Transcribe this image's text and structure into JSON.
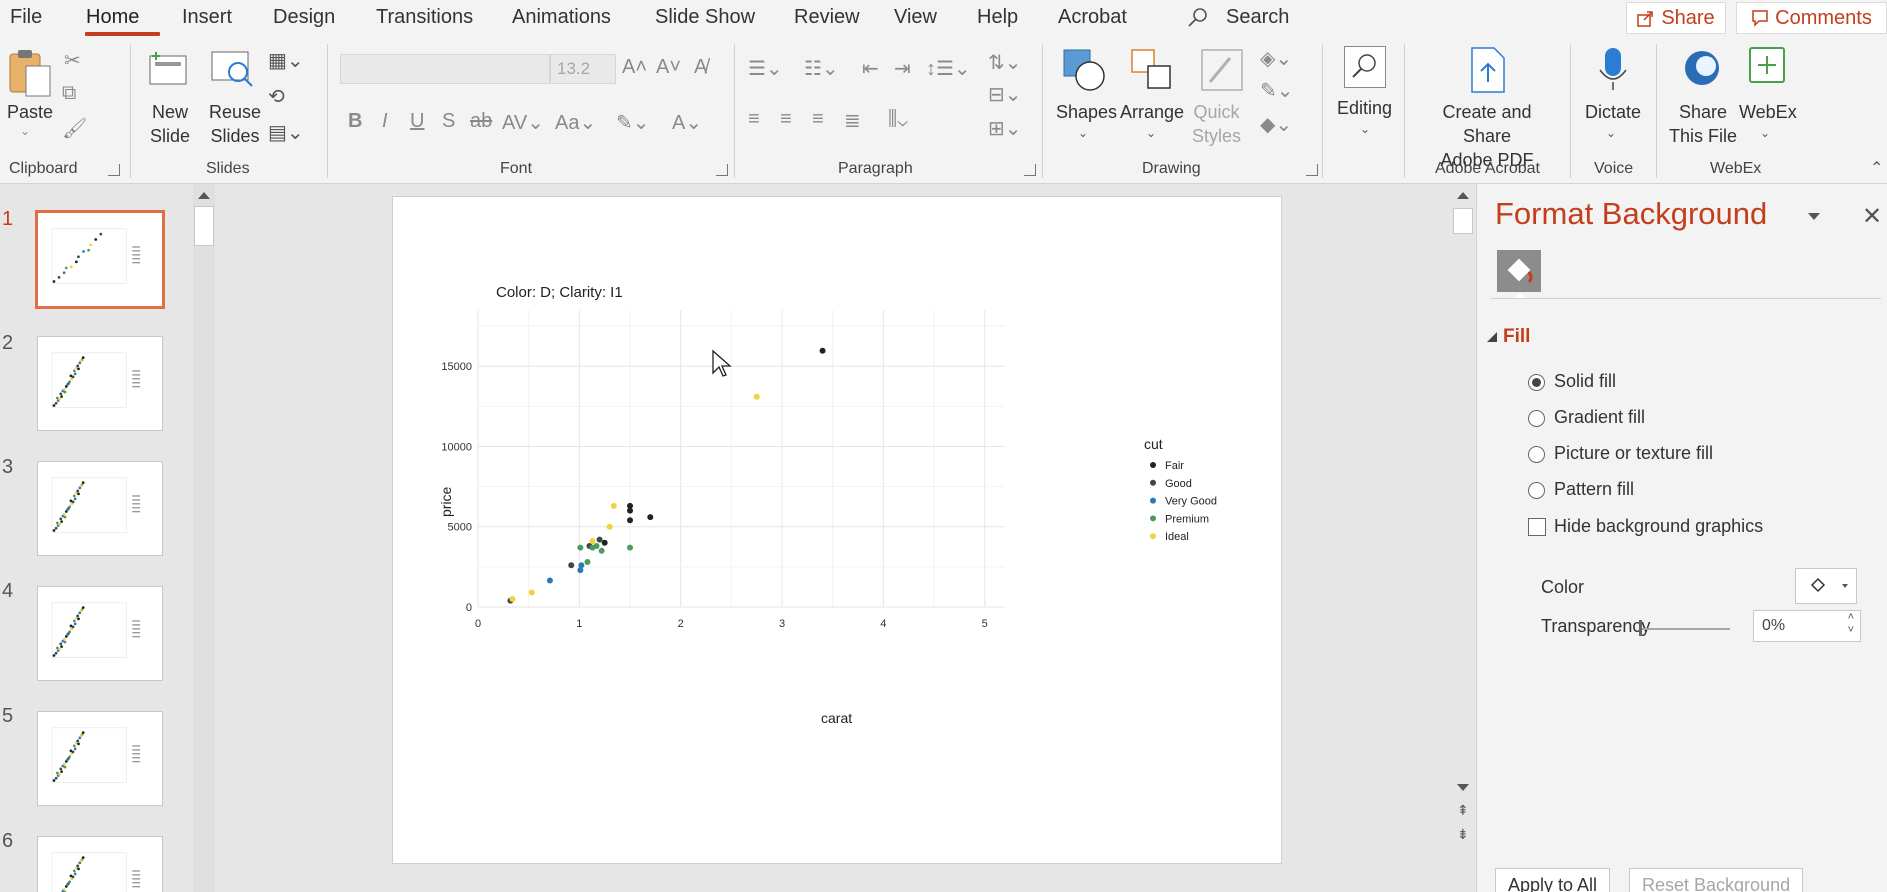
{
  "menu": {
    "items": [
      "File",
      "Home",
      "Insert",
      "Design",
      "Transitions",
      "Animations",
      "Slide Show",
      "Review",
      "View",
      "Help",
      "Acrobat"
    ],
    "active": "Home",
    "search_label": "Search",
    "share_label": "Share",
    "comments_label": "Comments"
  },
  "ribbon": {
    "clipboard": {
      "paste_label": "Paste",
      "group_label": "Clipboard"
    },
    "slides": {
      "new_slide_label": "New\nSlide",
      "reuse_slides_label": "Reuse\nSlides",
      "group_label": "Slides"
    },
    "font": {
      "font_name": "",
      "font_size": "13.2",
      "group_label": "Font"
    },
    "paragraph": {
      "group_label": "Paragraph"
    },
    "drawing": {
      "shapes_label": "Shapes",
      "arrange_label": "Arrange",
      "quick_styles_label": "Quick\nStyles",
      "group_label": "Drawing"
    },
    "editing": {
      "label": "Editing"
    },
    "adobe": {
      "label": "Create and Share\nAdobe PDF",
      "group_label": "Adobe Acrobat"
    },
    "voice": {
      "dictate_label": "Dictate",
      "group_label": "Voice"
    },
    "webex": {
      "share_label": "Share\nThis File",
      "webex_label": "WebEx",
      "group_label": "WebEx"
    }
  },
  "thumbnails": {
    "numbers": [
      "1",
      "2",
      "3",
      "4",
      "5",
      "6"
    ],
    "selected": "1"
  },
  "slide": {
    "chart_title": "Color: D; Clarity: I1"
  },
  "chart_data": {
    "type": "scatter",
    "title": "Color: D; Clarity: I1",
    "xlabel": "carat",
    "ylabel": "price",
    "xlim": [
      0,
      5.2
    ],
    "ylim": [
      0,
      18500
    ],
    "xticks": [
      0,
      1,
      2,
      3,
      4,
      5
    ],
    "yticks": [
      0,
      5000,
      10000,
      15000
    ],
    "grid": true,
    "legend_title": "cut",
    "legend_position": "right",
    "series": [
      {
        "name": "Fair",
        "color": "#222222",
        "points": [
          [
            3.4,
            15964
          ],
          [
            1.7,
            5600
          ],
          [
            1.5,
            5400
          ],
          [
            1.5,
            6300
          ],
          [
            1.5,
            6000
          ],
          [
            1.25,
            4000
          ]
        ]
      },
      {
        "name": "Good",
        "color": "#3d4550",
        "points": [
          [
            0.32,
            400
          ],
          [
            0.92,
            2600
          ],
          [
            1.2,
            4200
          ],
          [
            1.1,
            3800
          ]
        ]
      },
      {
        "name": "Very Good",
        "color": "#2a7ab8",
        "points": [
          [
            0.71,
            1650
          ],
          [
            1.01,
            2300
          ],
          [
            1.02,
            2600
          ]
        ]
      },
      {
        "name": "Premium",
        "color": "#4c9a5c",
        "points": [
          [
            1.01,
            3700
          ],
          [
            1.08,
            2800
          ],
          [
            1.13,
            3700
          ],
          [
            1.17,
            3800
          ],
          [
            1.5,
            3700
          ],
          [
            1.22,
            3500
          ]
        ]
      },
      {
        "name": "Ideal",
        "color": "#f0d23c",
        "points": [
          [
            2.75,
            13100
          ],
          [
            0.34,
            500
          ],
          [
            0.53,
            900
          ],
          [
            1.13,
            4100
          ],
          [
            1.3,
            5000
          ],
          [
            1.34,
            6300
          ]
        ]
      }
    ]
  },
  "pane": {
    "title": "Format Background",
    "section": "Fill",
    "options": [
      "Solid fill",
      "Gradient fill",
      "Picture or texture fill",
      "Pattern fill"
    ],
    "selected_option": "Solid fill",
    "hide_background_label": "Hide background graphics",
    "hide_background_checked": false,
    "color_label": "Color",
    "transparency_label": "Transparency",
    "transparency_value": "0%",
    "apply_all_label": "Apply to All",
    "reset_label": "Reset Background"
  },
  "colors": {
    "accent": "#c43e1c",
    "ribbon_bg": "#f3f3f3",
    "canvas_bg": "#e6e6e6"
  }
}
